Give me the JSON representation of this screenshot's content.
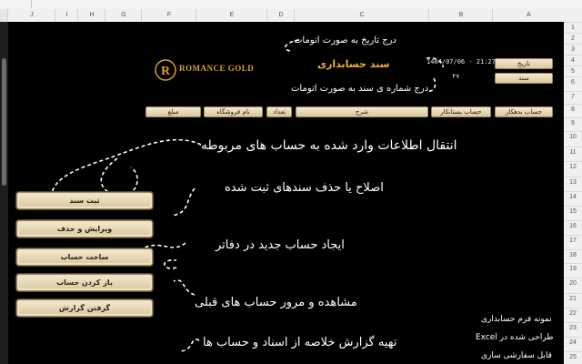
{
  "namebox": "",
  "columns": [
    "J",
    "I",
    "H",
    "G",
    "F",
    "E",
    "D",
    "C",
    "B",
    "A"
  ],
  "rows": [
    "1",
    "2",
    "3",
    "4",
    "5",
    "6",
    "7",
    "8",
    "9",
    "10",
    "11",
    "12",
    "13",
    "14",
    "15",
    "16",
    "17",
    "18",
    "19",
    "20",
    "21",
    "22",
    "23",
    "24",
    "25",
    "26",
    "27",
    "28",
    "29",
    "30",
    "31"
  ],
  "header": {
    "date_note": "درج تاریخ به صورت اتومات",
    "doc_number_note": "درج شماره ی سند به صورت اتومات",
    "doc_title": "سند حسابداری",
    "datetime_value": "1404/07/06 - 21:27:02",
    "doc_number_value": "۴۷",
    "logo_text": "ROMANCE GOLD",
    "date_label": "تاریخ",
    "doc_label": "سند"
  },
  "table_headers": {
    "debtor": "حساب بدهکار",
    "creditor": "حساب بستانکار",
    "description": "شرح",
    "quantity": "تعداد",
    "seller_name": "نام فروشگاه",
    "amount": "مبلغ"
  },
  "menu": {
    "submit": "ثبت سند",
    "edit_delete": "ویرایش و حذف",
    "create_account": "ساخت حساب",
    "open_account": "باز کردن حساب",
    "report": "گرفتن گزارش"
  },
  "annotations": {
    "transfer": "انتقال اطلاعات وارد شده به حساب های مربوطه",
    "edit": "اصلاح یا حذف سندهای ثبت شده",
    "create": "ایجاد حساب جدید در دفاتر",
    "review": "مشاهده و مرور حساب های قبلی",
    "report": "تهیه گزارش خلاصه از اسناد و حساب ها"
  },
  "footer_note": {
    "line1": "نمونه فرم حسابداری",
    "line2": "طراحی شده در Excel",
    "line3": "قابل سفارشی سازی"
  }
}
